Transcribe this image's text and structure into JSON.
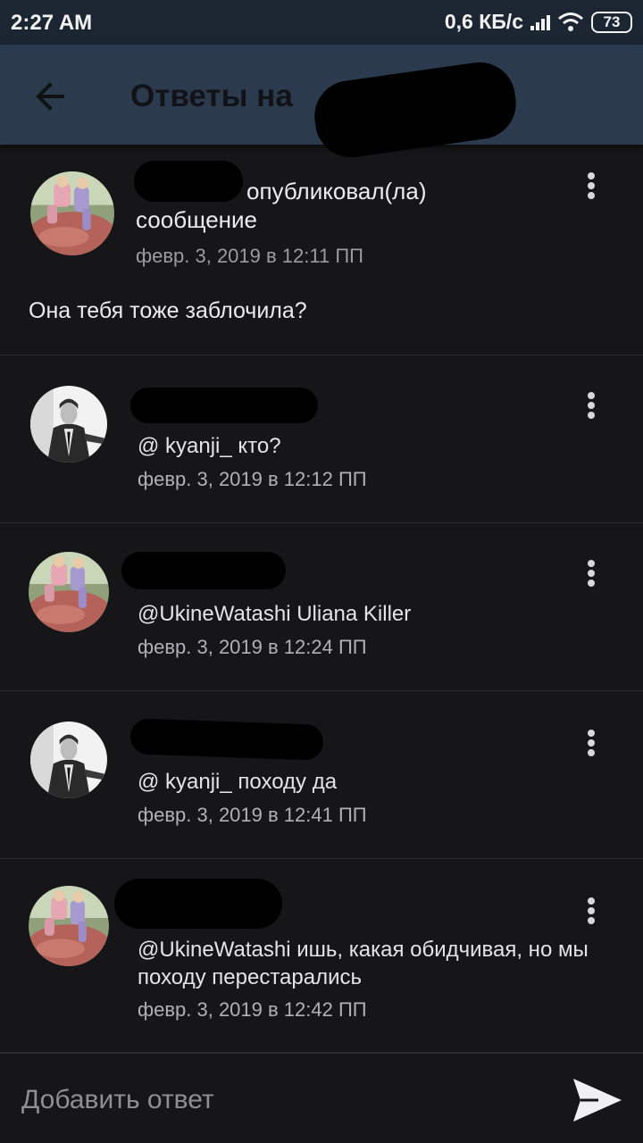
{
  "status_bar": {
    "time": "2:27 AM",
    "network_speed": "0,6 КБ/с",
    "battery": "73"
  },
  "header": {
    "title": "Ответы на"
  },
  "original_post": {
    "action": "опубликовал(ла) сообщение",
    "date": "февр. 3, 2019 в 12:11 ПП",
    "text": "Она тебя тоже заблочила?"
  },
  "replies": [
    {
      "text": "@ kyanji_  кто?",
      "date": "февр. 3, 2019 в 12:12 ПП"
    },
    {
      "text": "@UkineWatashi Uliana Killer",
      "date": "февр. 3, 2019 в 12:24 ПП"
    },
    {
      "text": "@ kyanji_  походу да",
      "date": "февр. 3, 2019 в 12:41 ПП"
    },
    {
      "text": "@UkineWatashi ишь, какая обидчивая, но мы походу перестарались",
      "date": "февр. 3, 2019 в 12:42 ПП"
    }
  ],
  "composer": {
    "placeholder": "Добавить ответ"
  },
  "icons": {
    "back": "arrow-left-icon",
    "more": "more-vertical-icon",
    "send": "send-icon",
    "wifi": "wifi-icon",
    "signal": "signal-icon",
    "battery": "battery-icon"
  }
}
